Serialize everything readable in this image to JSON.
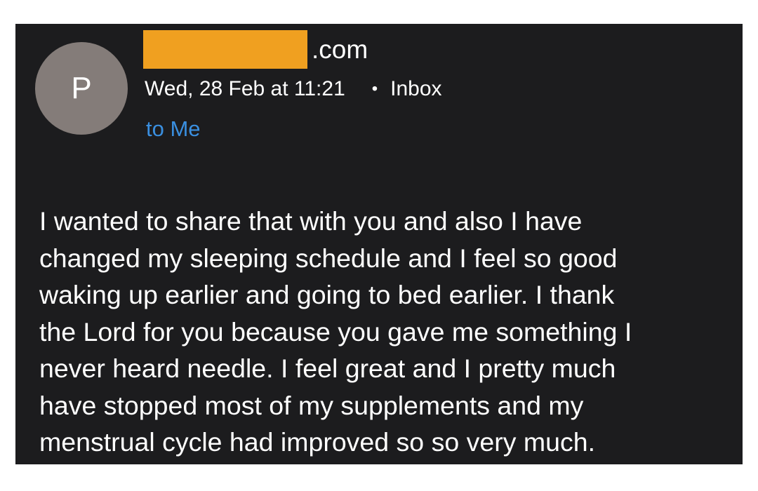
{
  "sender": {
    "avatar_initial": "P",
    "domain_suffix": ".com",
    "redaction_color": "#f0a020"
  },
  "meta": {
    "date": "Wed, 28 Feb at 11:21",
    "separator": "•",
    "folder": "Inbox"
  },
  "recipient": {
    "label": "to Me"
  },
  "body": {
    "lines": [
      "I wanted to share that with you and also I have",
      "changed my sleeping schedule and I feel so good",
      "waking up earlier and going to bed earlier. I thank",
      "the Lord for you because you gave me something I",
      "never heard needle. I feel great and I pretty much",
      "have stopped most of my supplements and my",
      "menstrual cycle had improved so so very much."
    ]
  },
  "colors": {
    "background": "#1c1c1e",
    "accent": "#3a8fe0",
    "avatar": "#847c79",
    "text": "#ffffff"
  }
}
